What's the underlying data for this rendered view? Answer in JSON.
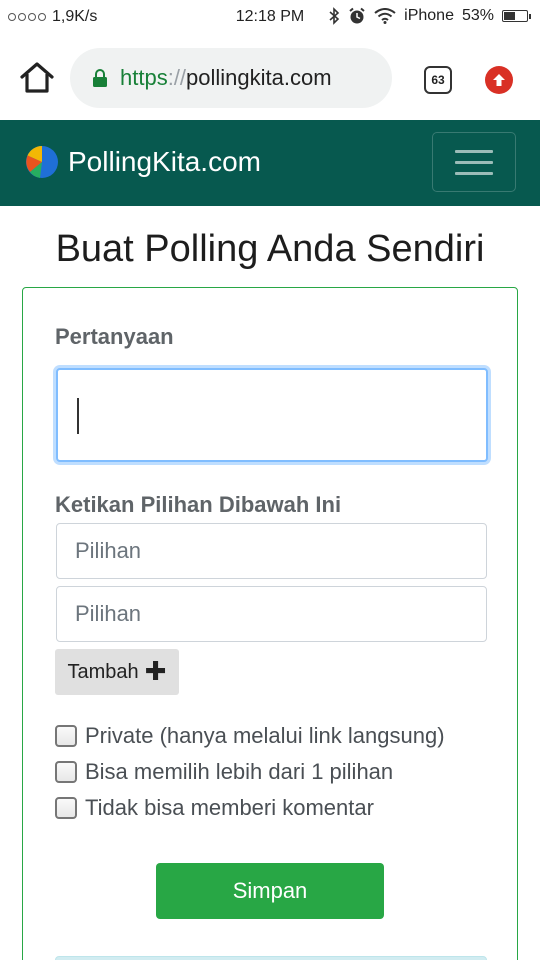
{
  "status_bar": {
    "network_speed": "1,9K/s",
    "time": "12:18 PM",
    "carrier": "iPhone",
    "battery_percent": "53%",
    "battery_level": 0.53
  },
  "browser": {
    "url_scheme": "https",
    "url_separator": "://",
    "url_host": "pollingkita.com",
    "tab_count": "63",
    "icons": [
      "home-icon",
      "lock-icon",
      "tabs-icon",
      "update-icon"
    ]
  },
  "navbar": {
    "brand": "PollingKita.com",
    "colors": {
      "background": "#07594f"
    }
  },
  "page": {
    "title": "Buat Polling Anda Sendiri"
  },
  "form": {
    "question_label": "Pertanyaan",
    "question_value": "",
    "choices_label": "Ketikan Pilihan Dibawah Ini",
    "choices": [
      {
        "placeholder": "Pilihan",
        "value": ""
      },
      {
        "placeholder": "Pilihan",
        "value": ""
      }
    ],
    "add_label": "Tambah",
    "options": [
      {
        "label": "Private (hanya melalui link langsung)",
        "checked": false
      },
      {
        "label": "Bisa memilih lebih dari 1 pilihan",
        "checked": false
      },
      {
        "label": "Tidak bisa memberi komentar",
        "checked": false
      }
    ],
    "save_label": "Simpan",
    "colors": {
      "accent": "#28a745",
      "focus": "#80bdff"
    }
  }
}
